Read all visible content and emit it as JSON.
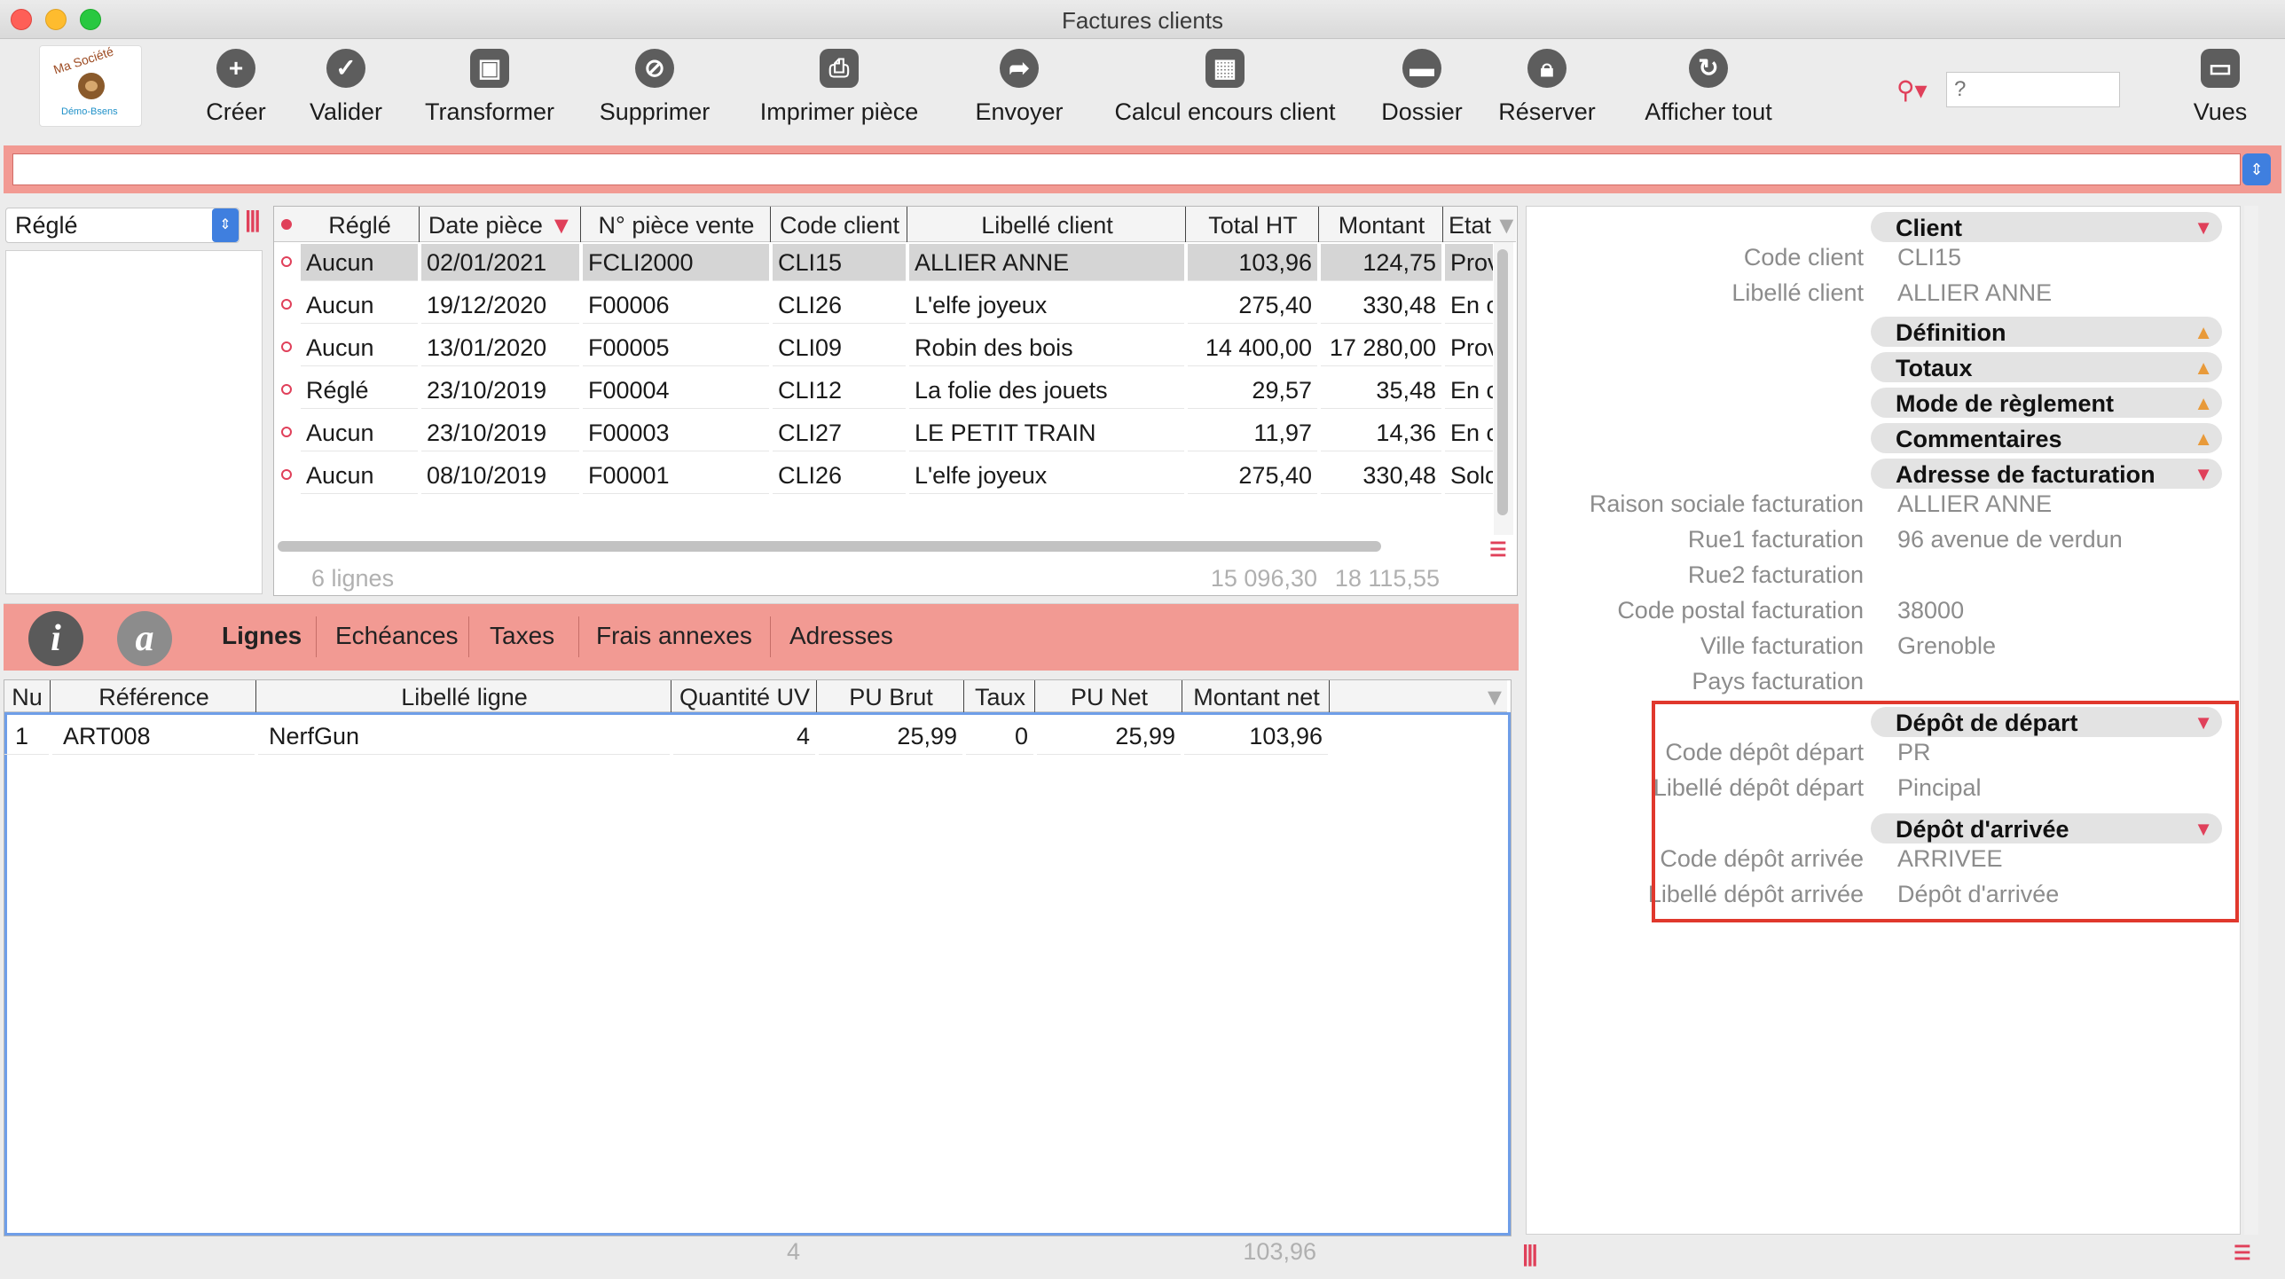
{
  "window": {
    "title": "Factures clients"
  },
  "logo": {
    "text_top": "Ma Société",
    "text_bottom": "Démo-Bsens"
  },
  "toolbar": {
    "buttons": [
      {
        "label": "Créer",
        "icon": "plus-icon"
      },
      {
        "label": "Valider",
        "icon": "check-icon"
      },
      {
        "label": "Transformer",
        "icon": "transform-icon"
      },
      {
        "label": "Supprimer",
        "icon": "prohibited-icon"
      },
      {
        "label": "Imprimer pièce",
        "icon": "printer-icon"
      },
      {
        "label": "Envoyer",
        "icon": "send-icon"
      },
      {
        "label": "Calcul encours client",
        "icon": "calculator-icon"
      },
      {
        "label": "Dossier",
        "icon": "folder-icon"
      },
      {
        "label": "Réserver",
        "icon": "lock-icon"
      },
      {
        "label": "Afficher tout",
        "icon": "refresh-icon"
      },
      {
        "label": "Vues",
        "icon": "monitor-icon"
      }
    ],
    "search_placeholder": "?"
  },
  "left_filter": {
    "selected": "Réglé"
  },
  "invoices": {
    "columns": [
      "Réglé",
      "Date pièce",
      "N° pièce vente",
      "Code client",
      "Libellé client",
      "Total HT",
      "Montant",
      "Etat"
    ],
    "rows": [
      [
        "Aucun",
        "02/01/2021",
        "FCLI2000",
        "CLI15",
        "ALLIER ANNE",
        "103,96",
        "124,75",
        "Prov"
      ],
      [
        "Aucun",
        "19/12/2020",
        "F00006",
        "CLI26",
        "L'elfe joyeux",
        "275,40",
        "330,48",
        "En c"
      ],
      [
        "Aucun",
        "13/01/2020",
        "F00005",
        "CLI09",
        "Robin des bois",
        "14 400,00",
        "17 280,00",
        "Prov"
      ],
      [
        "Réglé",
        "23/10/2019",
        "F00004",
        "CLI12",
        "La folie des jouets",
        "29,57",
        "35,48",
        "En c"
      ],
      [
        "Aucun",
        "23/10/2019",
        "F00003",
        "CLI27",
        "LE PETIT TRAIN",
        "11,97",
        "14,36",
        "En c"
      ],
      [
        "Aucun",
        "08/10/2019",
        "F00001",
        "CLI26",
        "L'elfe joyeux",
        "275,40",
        "330,48",
        "Solc"
      ]
    ],
    "footer": {
      "count": "6 lignes",
      "total_ht": "15 096,30",
      "montant": "18 115,55"
    }
  },
  "tabs": [
    "Lignes",
    "Echéances",
    "Taxes",
    "Frais annexes",
    "Adresses"
  ],
  "lines": {
    "columns": [
      "Nu",
      "Référence",
      "Libellé ligne",
      "Quantité UV",
      "PU Brut",
      "Taux",
      "PU Net",
      "Montant net"
    ],
    "rows": [
      [
        "1",
        "ART008",
        "NerfGun",
        "4",
        "25,99",
        "0",
        "25,99",
        "103,96"
      ]
    ],
    "footer": {
      "quantity": "4",
      "amount": "103,96"
    }
  },
  "details": {
    "client": {
      "title": "Client",
      "code_label": "Code client",
      "code": "CLI15",
      "name_label": "Libellé client",
      "name": "ALLIER ANNE"
    },
    "collapsed": [
      "Définition",
      "Totaux",
      "Mode de règlement",
      "Commentaires"
    ],
    "billing": {
      "title": "Adresse de facturation",
      "fields": [
        {
          "label": "Raison sociale facturation",
          "value": "ALLIER ANNE"
        },
        {
          "label": "Rue1 facturation",
          "value": "96 avenue de verdun"
        },
        {
          "label": "Rue2 facturation",
          "value": ""
        },
        {
          "label": "Code postal facturation",
          "value": "38000"
        },
        {
          "label": "Ville facturation",
          "value": "Grenoble"
        },
        {
          "label": "Pays facturation",
          "value": ""
        }
      ]
    },
    "depart": {
      "title": "Dépôt de départ",
      "code_label": "Code dépôt départ",
      "code": "PR",
      "name_label": "Libellé dépôt départ",
      "name": "Pincipal"
    },
    "arrivee": {
      "title": "Dépôt d'arrivée",
      "code_label": "Code dépôt arrivée",
      "code": "ARRIVEE",
      "name_label": "Libellé dépôt arrivée",
      "name": "Dépôt d'arrivée"
    }
  },
  "colors": {
    "accent_red": "#e0405a",
    "bar_salmon": "#f29a93",
    "highlight_box": "#e0382d",
    "selection_blue": "#6f9ee8"
  }
}
